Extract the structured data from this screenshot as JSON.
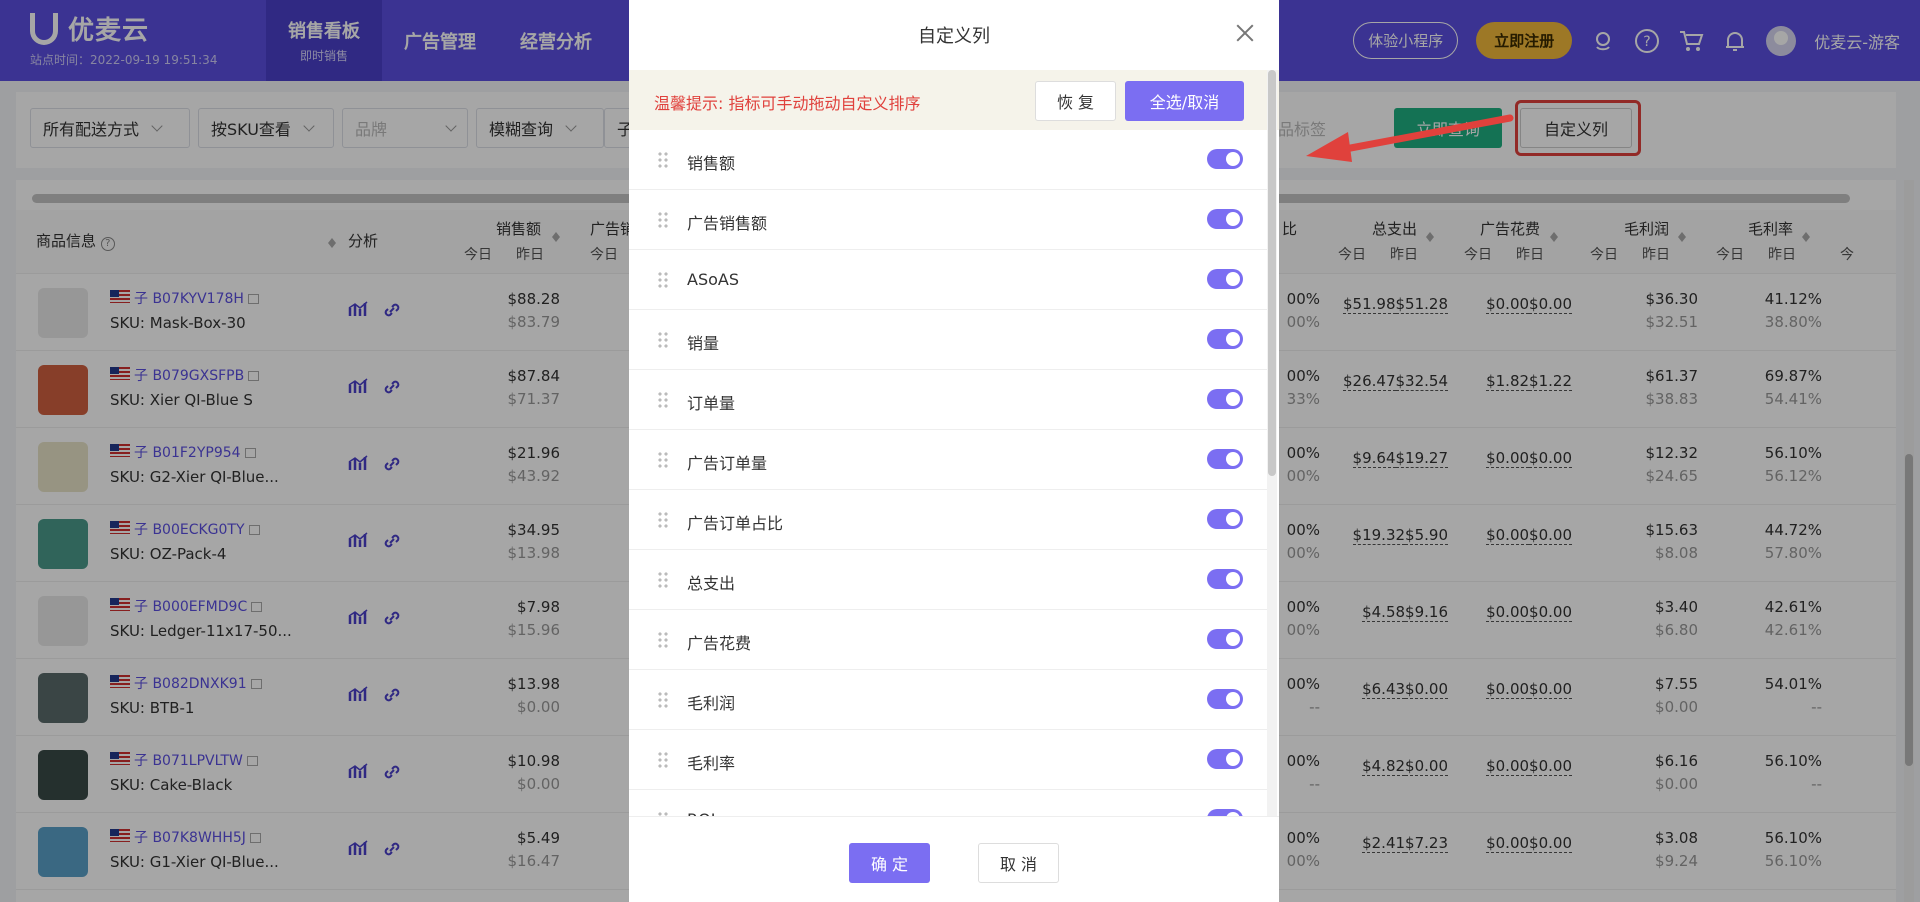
{
  "nav": {
    "brand": "优麦云",
    "site_time": "站点时间：2022-09-19 19:51:34",
    "tabs": [
      {
        "label": "销售看板",
        "sub": "即时销售"
      },
      {
        "label": "广告管理",
        "sub": ""
      },
      {
        "label": "经营分析",
        "sub": ""
      }
    ],
    "mini_program": "体验小程序",
    "register": "立即注册",
    "username": "优麦云-游客"
  },
  "filters": {
    "delivery": "所有配送方式",
    "view_by": "按SKU查看",
    "brand_placeholder": "品牌",
    "search_mode": "模糊查询",
    "child": "子",
    "tag_placeholder": "品标签",
    "query_button": "立即查询",
    "custom_columns_button": "自定义列"
  },
  "table": {
    "product_info": "商品信息",
    "analysis": "分析",
    "today": "今日",
    "yesterday": "昨日",
    "columns": {
      "sales": "销售额",
      "ad_sales": "广告销",
      "ratio": "比",
      "total_spend": "总支出",
      "ad_spend": "广告花费",
      "gross_profit": "毛利润",
      "gross_margin": "毛利率",
      "more": "今"
    },
    "rows": [
      {
        "asin": "B07KYV178H",
        "sku": "SKU: Mask-Box-30",
        "sales_t": "$88.28",
        "sales_y": "$83.79",
        "ratio_t": "00%",
        "ratio_y": "00%",
        "spend_t": "$51.98",
        "spend_y": "$51.28",
        "ad_t": "$0.00",
        "ad_y": "$0.00",
        "gp_t": "$36.30",
        "gp_y": "$32.51",
        "gm_t": "41.12%",
        "gm_y": "38.80%"
      },
      {
        "asin": "B079GXSFPB",
        "sku": "SKU: Xier QI-Blue S",
        "sales_t": "$87.84",
        "sales_y": "$71.37",
        "ratio_t": "00%",
        "ratio_y": "33%",
        "spend_t": "$26.47",
        "spend_y": "$32.54",
        "ad_t": "$1.82",
        "ad_y": "$1.22",
        "gp_t": "$61.37",
        "gp_y": "$38.83",
        "gm_t": "69.87%",
        "gm_y": "54.41%"
      },
      {
        "asin": "B01F2YP954",
        "sku": "SKU: G2-Xier QI-Blue...",
        "sales_t": "$21.96",
        "sales_y": "$43.92",
        "ratio_t": "00%",
        "ratio_y": "00%",
        "spend_t": "$9.64",
        "spend_y": "$19.27",
        "ad_t": "$0.00",
        "ad_y": "$0.00",
        "gp_t": "$12.32",
        "gp_y": "$24.65",
        "gm_t": "56.10%",
        "gm_y": "56.12%"
      },
      {
        "asin": "B00ECKG0TY",
        "sku": "SKU: OZ-Pack-4",
        "sales_t": "$34.95",
        "sales_y": "$13.98",
        "ratio_t": "00%",
        "ratio_y": "00%",
        "spend_t": "$19.32",
        "spend_y": "$5.90",
        "ad_t": "$0.00",
        "ad_y": "$0.00",
        "gp_t": "$15.63",
        "gp_y": "$8.08",
        "gm_t": "44.72%",
        "gm_y": "57.80%"
      },
      {
        "asin": "B000EFMD9C",
        "sku": "SKU: Ledger-11x17-50...",
        "sales_t": "$7.98",
        "sales_y": "$15.96",
        "ratio_t": "00%",
        "ratio_y": "00%",
        "spend_t": "$4.58",
        "spend_y": "$9.16",
        "ad_t": "$0.00",
        "ad_y": "$0.00",
        "gp_t": "$3.40",
        "gp_y": "$6.80",
        "gm_t": "42.61%",
        "gm_y": "42.61%"
      },
      {
        "asin": "B082DNXK91",
        "sku": "SKU: BTB-1",
        "sales_t": "$13.98",
        "sales_y": "$0.00",
        "ratio_t": "00%",
        "ratio_y": "--",
        "spend_t": "$6.43",
        "spend_y": "$0.00",
        "ad_t": "$0.00",
        "ad_y": "$0.00",
        "gp_t": "$7.55",
        "gp_y": "$0.00",
        "gm_t": "54.01%",
        "gm_y": "--"
      },
      {
        "asin": "B071LPVLTW",
        "sku": "SKU: Cake-Black",
        "sales_t": "$10.98",
        "sales_y": "$0.00",
        "ratio_t": "00%",
        "ratio_y": "--",
        "spend_t": "$4.82",
        "spend_y": "$0.00",
        "ad_t": "$0.00",
        "ad_y": "$0.00",
        "gp_t": "$6.16",
        "gp_y": "$0.00",
        "gm_t": "56.10%",
        "gm_y": "--"
      },
      {
        "asin": "B07K8WHH5J",
        "sku": "SKU: G1-Xier QI-Blue...",
        "sales_t": "$5.49",
        "sales_y": "$16.47",
        "ratio_t": "00%",
        "ratio_y": "00%",
        "spend_t": "$2.41",
        "spend_y": "$7.23",
        "ad_t": "$0.00",
        "ad_y": "$0.00",
        "gp_t": "$3.08",
        "gp_y": "$9.24",
        "gm_t": "56.10%",
        "gm_y": "56.10%"
      }
    ]
  },
  "modal": {
    "title": "自定义列",
    "tip": "温馨提示: 指标可手动拖动自定义排序",
    "restore": "恢 复",
    "select_all": "全选/取消",
    "items": [
      "销售额",
      "广告销售额",
      "ASoAS",
      "销量",
      "订单量",
      "广告订单量",
      "广告订单占比",
      "总支出",
      "广告花费",
      "毛利润",
      "毛利率",
      "ROI"
    ],
    "ok": "确 定",
    "cancel": "取 消"
  },
  "colors": {
    "nav": "#5b4fe0",
    "accent": "#7b6ef2",
    "query": "#1fb082",
    "tip_text": "#e0413c",
    "register": "#f2b93b"
  },
  "icons": [
    "search-icon",
    "help-icon",
    "cart-icon",
    "bell-icon",
    "support-icon",
    "chart-icon",
    "link-icon",
    "external-link-icon",
    "close-icon",
    "drag-handle-icon",
    "chevron-down-icon",
    "us-flag-icon"
  ]
}
